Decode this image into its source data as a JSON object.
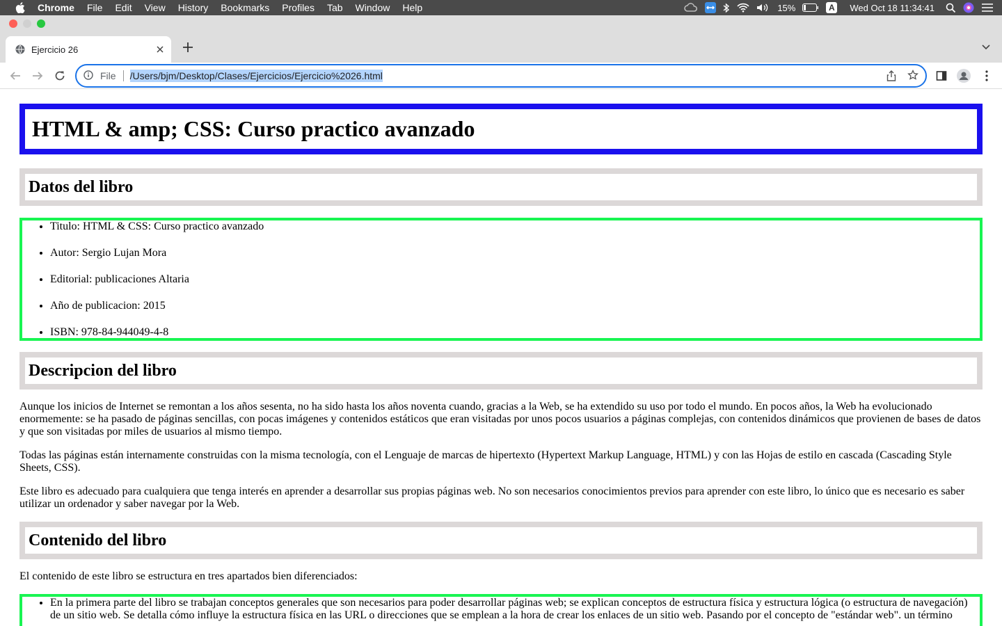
{
  "menubar": {
    "app": "Chrome",
    "items": [
      "File",
      "Edit",
      "View",
      "History",
      "Bookmarks",
      "Profiles",
      "Tab",
      "Window",
      "Help"
    ],
    "battery": "15%",
    "input": "A",
    "clock": "Wed Oct 18  11:34:41"
  },
  "browser": {
    "tab_title": "Ejercicio 26",
    "scheme_label": "File",
    "url": "/Users/bjm/Desktop/Clases/Ejercicios/Ejercicio%2026.html"
  },
  "page": {
    "title": "HTML & amp; CSS: Curso practico avanzado",
    "section1": {
      "heading": "Datos del libro",
      "items": [
        "Titulo: HTML & CSS: Curso practico avanzado",
        "Autor: Sergio Lujan Mora",
        "Editorial: publicaciones Altaria",
        "Año de publicacion: 2015",
        "ISBN: 978-84-944049-4-8"
      ]
    },
    "section2": {
      "heading": "Descripcion del libro",
      "paragraphs": [
        "Aunque los inicios de Internet se remontan a los años sesenta, no ha sido hasta los años noventa cuando, gracias a la Web, se ha extendido su uso por todo el mundo. En pocos años, la Web ha evolucionado enormemente: se ha pasado de páginas sencillas, con pocas imágenes y contenidos estáticos que eran visitadas por unos pocos usuarios a páginas complejas, con contenidos dinámicos que provienen de bases de datos y que son visitadas por miles de usuarios al mismo tiempo.",
        "Todas las páginas están internamente construidas con la misma tecnología, con el Lenguaje de marcas de hipertexto (Hypertext Markup Language, HTML) y con las Hojas de estilo en cascada (Cascading Style Sheets, CSS).",
        "Este libro es adecuado para cualquiera que tenga interés en aprender a desarrollar sus propias páginas web. No son necesarios conocimientos previos para aprender con este libro, lo único que es necesario es saber utilizar un ordenador y saber navegar por la Web."
      ]
    },
    "section3": {
      "heading": "Contenido del libro",
      "intro": "El contenido de este libro se estructura en tres apartados bien diferenciados:",
      "items": [
        "En la primera parte del libro se trabajan conceptos generales que son necesarios para poder desarrollar páginas web; se explican conceptos de estructura física y estructura lógica (o estructura de navegación) de un sitio web. Se detalla cómo influye la estructura física en las URL o direcciones que se emplean a la hora de crear los enlaces de un sitio web. Pasando por el concepto de \"estándar web\". un término"
      ]
    }
  },
  "colors": {
    "title_border": "#1a10ee",
    "heading_border": "#dcd8d8",
    "list_border": "#19f552",
    "omnibox_focus": "#1a73e8"
  }
}
